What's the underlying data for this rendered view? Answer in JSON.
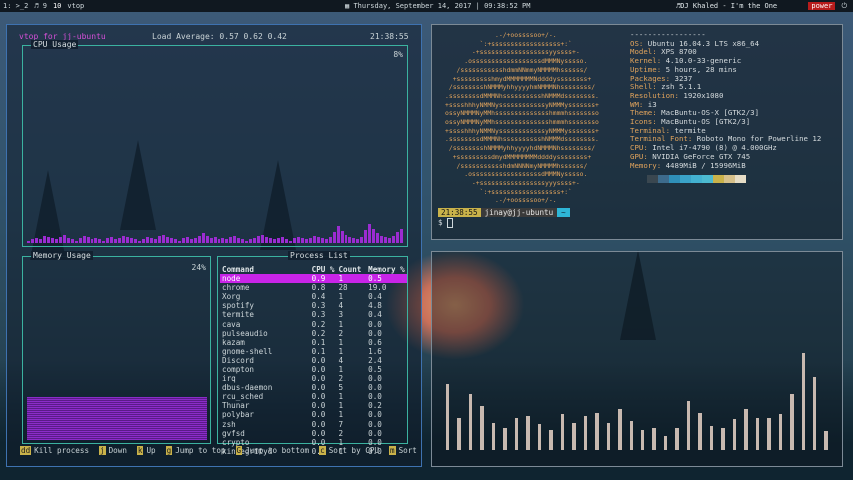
{
  "topbar": {
    "workspaces": [
      "1: >_2",
      "♬ 9",
      "10",
      "vtop"
    ],
    "clock": "Thursday, September 14, 2017 | 09:38:52 PM",
    "music": "DJ Khaled - I'm the One",
    "badge": "power"
  },
  "vtop": {
    "title": "vtop for jj-ubuntu",
    "load_average": "Load Average: 0.57 0.62 0.42",
    "time": "21:38:55",
    "cpu_title": "CPU Usage",
    "cpu_percent": "8%",
    "cpu_history": [
      2,
      3,
      4,
      3,
      6,
      5,
      4,
      3,
      5,
      7,
      4,
      3,
      2,
      4,
      6,
      5,
      3,
      4,
      3,
      2,
      4,
      5,
      3,
      4,
      6,
      5,
      4,
      3,
      2,
      3,
      5,
      4,
      3,
      6,
      7,
      5,
      4,
      3,
      2,
      4,
      5,
      3,
      4,
      6,
      8,
      6,
      4,
      5,
      3,
      4,
      3,
      5,
      6,
      4,
      3,
      2,
      3,
      4,
      6,
      7,
      5,
      4,
      3,
      4,
      5,
      3,
      2,
      4,
      5,
      4,
      3,
      4,
      6,
      5,
      4,
      3,
      5,
      9,
      14,
      10,
      7,
      5,
      4,
      3,
      5,
      11,
      16,
      12,
      8,
      6,
      5,
      4,
      6,
      9,
      12
    ],
    "mem_title": "Memory Usage",
    "mem_percent": "24%",
    "mem_fraction": 0.24,
    "proc_title": "Process List",
    "headers": [
      "Command",
      "CPU %",
      "Count",
      "Memory %"
    ],
    "processes": [
      [
        "node",
        "0.9",
        "1",
        "0.5"
      ],
      [
        "chrome",
        "0.8",
        "28",
        "19.0"
      ],
      [
        "Xorg",
        "0.4",
        "1",
        "0.4"
      ],
      [
        "spotify",
        "0.3",
        "4",
        "4.8"
      ],
      [
        "termite",
        "0.3",
        "3",
        "0.4"
      ],
      [
        "cava",
        "0.2",
        "1",
        "0.0"
      ],
      [
        "pulseaudio",
        "0.2",
        "2",
        "0.0"
      ],
      [
        "kazam",
        "0.1",
        "1",
        "0.6"
      ],
      [
        "gnome-shell",
        "0.1",
        "1",
        "1.6"
      ],
      [
        "Discord",
        "0.0",
        "4",
        "2.4"
      ],
      [
        "compton",
        "0.0",
        "1",
        "0.5"
      ],
      [
        "irq",
        "0.0",
        "2",
        "0.0"
      ],
      [
        "dbus-daemon",
        "0.0",
        "5",
        "0.0"
      ],
      [
        "rcu_sched",
        "0.0",
        "1",
        "0.0"
      ],
      [
        "Thunar",
        "0.0",
        "1",
        "0.2"
      ],
      [
        "polybar",
        "0.0",
        "1",
        "0.0"
      ],
      [
        "zsh",
        "0.0",
        "7",
        "0.0"
      ],
      [
        "gvfsd",
        "0.0",
        "2",
        "0.0"
      ],
      [
        "crypto",
        "0.0",
        "1",
        "0.0"
      ],
      [
        "kintegrityd",
        "0.0",
        "1",
        "0.0"
      ]
    ],
    "footer": [
      {
        "key": "dd",
        "label": "Kill process"
      },
      {
        "key": "j",
        "label": "Down"
      },
      {
        "key": "k",
        "label": "Up"
      },
      {
        "key": "g",
        "label": "Jump to top"
      },
      {
        "key": "G",
        "label": "Jump to bottom"
      },
      {
        "key": "c",
        "label": "Sort by CPU"
      },
      {
        "key": "m",
        "label": "Sort"
      }
    ]
  },
  "neofetch": {
    "ascii": [
      "             .-/+oossssoo+/-.",
      "         `:+ssssssssssssssssss+:`",
      "       -+ssssssssssssssssssyyssss+-",
      "     .ossssssssssssssssssdMMMNysssso.",
      "   /ssssssssssshdmmNNmmyNMMMMhssssss/",
      "  +ssssssssshmydMMMMMMMNddddyssssssss+",
      " /sssssssshNMMMyhhyyyyhmNMMMNhssssssss/",
      ".ssssssssdMMMNhsssssssssshNMMMdssssssss.",
      "+sssshhhyNMMNyssssssssssssyNMMMysssssss+",
      "ossyNMMMNyMMhsssssssssssssshmmmhssssssso",
      "ossyNMMMNyMMhsssssssssssssshmmmhssssssso",
      "+sssshhhyNMMNyssssssssssssyNMMMysssssss+",
      ".ssssssssdMMMNhsssssssssshNMMMdssssssss.",
      " /sssssssshNMMMyhhyyyyhdNMMMNhssssssss/",
      "  +sssssssssdmydMMMMMMMMddddyssssssss+",
      "   /ssssssssssshdmNNNNmyNMMMMhssssss/",
      "     .ossssssssssssssssssdMMMNysssso.",
      "       -+sssssssssssssssssyyyssss+-",
      "         `:+ssssssssssssssssss+:`",
      "             .-/+oossssoo+/-."
    ],
    "info": [
      {
        "k": "",
        "v": "-----------------"
      },
      {
        "k": "OS:",
        "v": "Ubuntu 16.04.3 LTS x86_64"
      },
      {
        "k": "Model:",
        "v": "XPS 8700"
      },
      {
        "k": "Kernel:",
        "v": "4.10.0-33-generic"
      },
      {
        "k": "Uptime:",
        "v": "5 hours, 28 mins"
      },
      {
        "k": "Packages:",
        "v": "3237"
      },
      {
        "k": "Shell:",
        "v": "zsh 5.1.1"
      },
      {
        "k": "Resolution:",
        "v": "1920x1080"
      },
      {
        "k": "WM:",
        "v": "i3"
      },
      {
        "k": "Theme:",
        "v": "MacBuntu-OS-X [GTK2/3]"
      },
      {
        "k": "Icons:",
        "v": "MacBuntu-OS [GTK2/3]"
      },
      {
        "k": "Terminal:",
        "v": "termite"
      },
      {
        "k": "Terminal Font:",
        "v": "Roboto Mono for Powerline 12"
      },
      {
        "k": "CPU:",
        "v": "Intel i7-4790 (8) @ 4.000GHz"
      },
      {
        "k": "GPU:",
        "v": "NVIDIA GeForce GTX 745"
      },
      {
        "k": "Memory:",
        "v": "4489MiB / 15996MiB"
      }
    ],
    "swatches": [
      "#3a4750",
      "#3d6b8c",
      "#2f8fb8",
      "#3aa3c9",
      "#43b1d0",
      "#4cbad0",
      "#c9b24a",
      "#d6c08a",
      "#e6ddc6"
    ],
    "prompt_time": "21:38:55",
    "prompt_user": "jinay@jj-ubuntu",
    "prompt_dir": "~",
    "prompt2": "$ "
  },
  "visualizer": {
    "levels": [
      0.39,
      0.19,
      0.33,
      0.26,
      0.16,
      0.13,
      0.19,
      0.2,
      0.15,
      0.12,
      0.21,
      0.16,
      0.2,
      0.22,
      0.16,
      0.24,
      0.17,
      0.12,
      0.13,
      0.08,
      0.13,
      0.29,
      0.22,
      0.14,
      0.13,
      0.18,
      0.24,
      0.19,
      0.19,
      0.21,
      0.33,
      0.57,
      0.43,
      0.11
    ]
  }
}
